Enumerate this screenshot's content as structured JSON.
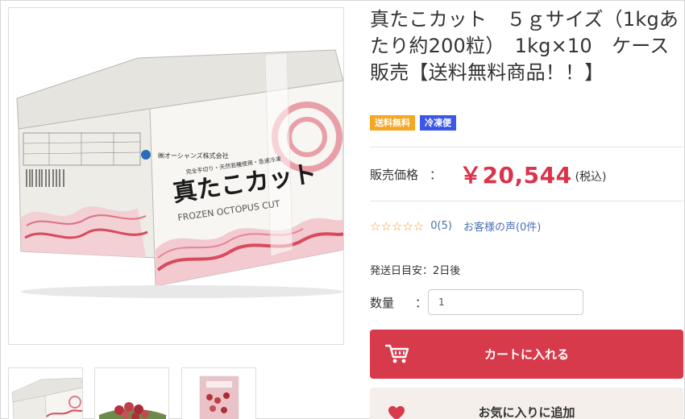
{
  "product": {
    "title": "真たこカット　５ｇサイズ（1kgあたり約200粒）　1kg×10　ケース販売【送料無料商品！！】",
    "badges": {
      "free_shipping": "送料無料",
      "frozen": "冷凍便"
    },
    "price": {
      "label": "販売価格",
      "colon": "：",
      "value": "￥20,544",
      "tax_note": "(税込)"
    },
    "review": {
      "stars": "☆☆☆☆☆",
      "count": "0(5)",
      "link": "お客様の声(0件)"
    },
    "shipping": {
      "label": "発送日目安：",
      "value": "2日後"
    },
    "quantity": {
      "label": "数量",
      "colon": "：",
      "value": "1"
    },
    "cart_button": "カートに入れる",
    "favorite_button": "お気に入りに追加"
  },
  "image_labels": {
    "box_title": "真たこカット",
    "box_subtitle": "FROZEN OCTOPUS CUT",
    "box_maker": "㈱オーシャンズ株式会社",
    "box_tagline": "完全手切り・天然若種使用・急速冷凍"
  },
  "colors": {
    "price": "#d9344a",
    "cart_button": "#d63a4b",
    "badge_shipping": "#f5a623",
    "badge_frozen": "#3a57e8",
    "link": "#4a6fb5"
  }
}
